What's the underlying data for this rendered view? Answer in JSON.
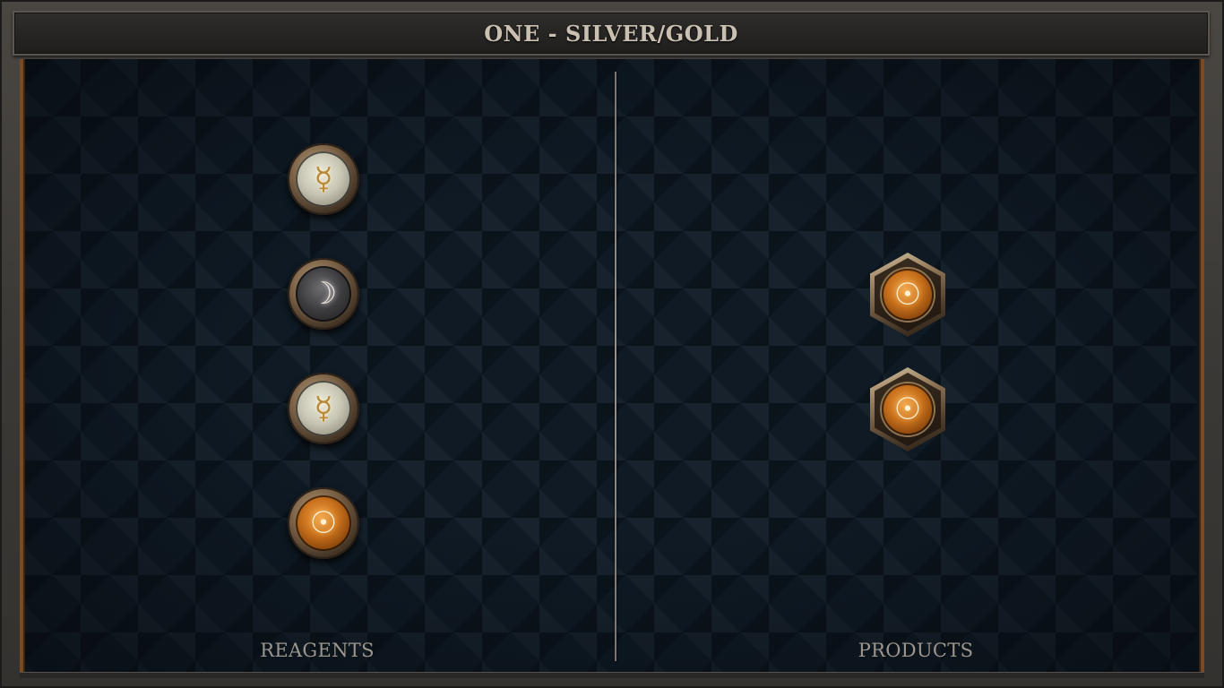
{
  "title": "ONE - SILVER/GOLD",
  "panels": {
    "reagents": {
      "label": "REAGENTS",
      "items": [
        {
          "element": "quicksilver",
          "symbol": "☿",
          "icon": "mercury-icon"
        },
        {
          "element": "moon",
          "symbol": "☽",
          "icon": "moon-icon"
        },
        {
          "element": "quicksilver",
          "symbol": "☿",
          "icon": "mercury-icon"
        },
        {
          "element": "sun",
          "symbol": "☉",
          "icon": "sun-icon"
        }
      ]
    },
    "products": {
      "label": "PRODUCTS",
      "items": [
        {
          "element": "sun",
          "symbol": "☉",
          "icon": "sun-icon"
        },
        {
          "element": "sun",
          "symbol": "☉",
          "icon": "sun-icon"
        }
      ]
    }
  },
  "colors": {
    "frame": "#3a3835",
    "board": "#0f1a24",
    "accent_copper": "#7a4a22",
    "title_text": "#c9c0b2",
    "label_text": "#9c968d"
  }
}
